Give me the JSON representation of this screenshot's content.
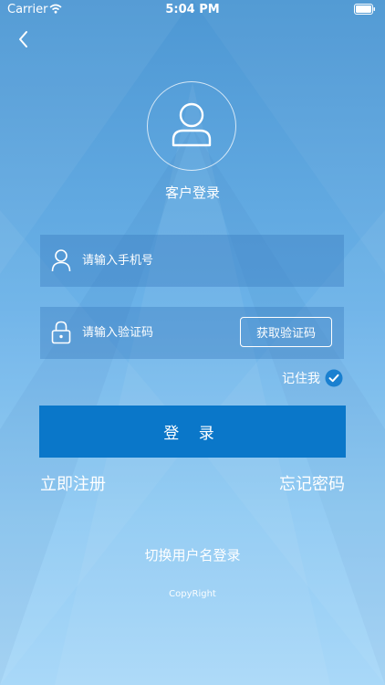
{
  "status_bar": {
    "carrier": "Carrier",
    "time": "5:04 PM"
  },
  "header": {
    "back_icon": "chevron-left-icon"
  },
  "login": {
    "title": "客户登录",
    "avatar_icon": "user-icon",
    "phone": {
      "placeholder": "请输入手机号",
      "value": "",
      "icon": "user-icon"
    },
    "code": {
      "placeholder": "请输入验证码",
      "value": "",
      "icon": "lock-icon",
      "get_code_label": "获取验证码"
    },
    "remember": {
      "label": "记住我",
      "checked": true
    },
    "submit_label": "登 录",
    "register_label": "立即注册",
    "forgot_label": "忘记密码",
    "switch_label": "切换用户名登录",
    "copyright": "CopyRight"
  },
  "colors": {
    "primary_button": "#0a77c9",
    "check_accent": "#1a80d0",
    "background_top": "#4d97d3",
    "background_bottom": "#a9d8f8"
  }
}
